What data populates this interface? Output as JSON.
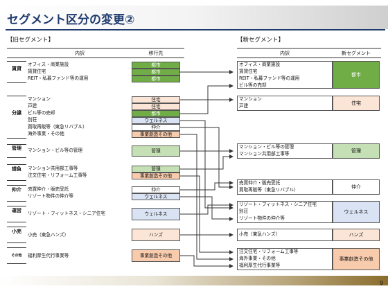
{
  "title": "セグメント区分の変更②",
  "old": {
    "label": "【旧セグメント】",
    "header_items": "内訳",
    "header_dest": "移行先",
    "groups": [
      {
        "cat": "賃貸",
        "rows": [
          {
            "item": "オフィス・商業施設",
            "dest": "都市"
          },
          {
            "item": "賃貸住宅",
            "dest": "都市"
          },
          {
            "item": "REIT・私募ファンド等の運用",
            "dest": "都市"
          }
        ]
      },
      {
        "cat": "分譲",
        "rows": [
          {
            "item": "マンション",
            "dest": "住宅"
          },
          {
            "item": "戸建",
            "dest": "住宅"
          },
          {
            "item": "ビル等の売却",
            "dest": "都市"
          },
          {
            "item": "別荘",
            "dest": "ウェルネス"
          },
          {
            "item": "買取再販等（東急リバブル）",
            "dest": "仲介"
          },
          {
            "item": "海外事業・その他",
            "dest": "事業創造その他"
          }
        ]
      },
      {
        "cat": "管理",
        "rows": [
          {
            "item": "マンション・ビル等の管理",
            "dest": "管理"
          }
        ]
      },
      {
        "cat": "請負",
        "rows": [
          {
            "item": "マンション共用部工事等",
            "dest": "管理"
          },
          {
            "item": "注文住宅・リフォーム工事等",
            "dest": "事業創造その他"
          }
        ]
      },
      {
        "cat": "仲介",
        "rows": [
          {
            "item": "売買仲介・販売受託",
            "dest": "仲介"
          },
          {
            "item": "リゾート物件の仲介等",
            "dest": "ウェルネス"
          }
        ]
      },
      {
        "cat": "運営",
        "rows": [
          {
            "item": "リゾート・フィットネス・シニア住宅",
            "dest": "ウェルネス"
          }
        ]
      },
      {
        "cat": "小売",
        "rows": [
          {
            "item": "小売（東急ハンズ）",
            "dest": "ハンズ"
          }
        ]
      },
      {
        "cat": "その他",
        "rows": [
          {
            "item": "福利厚生代行事業等",
            "dest": "事業創造その他"
          }
        ]
      }
    ]
  },
  "new": {
    "label": "【新セグメント】",
    "header_items": "内訳",
    "header_seg": "新セグメント",
    "groups": [
      {
        "items": [
          "オフィス・商業施設",
          "賃貸住宅",
          "REIT・私募ファンド等の運用",
          "ビル等の売却"
        ],
        "seg": "都市"
      },
      {
        "items": [
          "マンション",
          "戸建"
        ],
        "seg": "住宅"
      },
      {
        "items": [
          "マンション・ビル等の管理",
          "マンション共用部工事等"
        ],
        "seg": "管理"
      },
      {
        "items": [
          "売買仲介・販売受託",
          "買取再販等（東急リバブル）"
        ],
        "seg": "仲介"
      },
      {
        "items": [
          "リゾート・フィットネス・シニア住宅",
          "別荘",
          "リゾート物件の仲介等"
        ],
        "seg": "ウェルネス"
      },
      {
        "items": [
          "小売（東急ハンズ）"
        ],
        "seg": "ハンズ"
      },
      {
        "items": [
          "注文住宅・リフォーム工事等",
          "海外事業・その他",
          "福利厚生代行事業等"
        ],
        "seg": "事業創造その他"
      }
    ]
  },
  "page_number": "9"
}
